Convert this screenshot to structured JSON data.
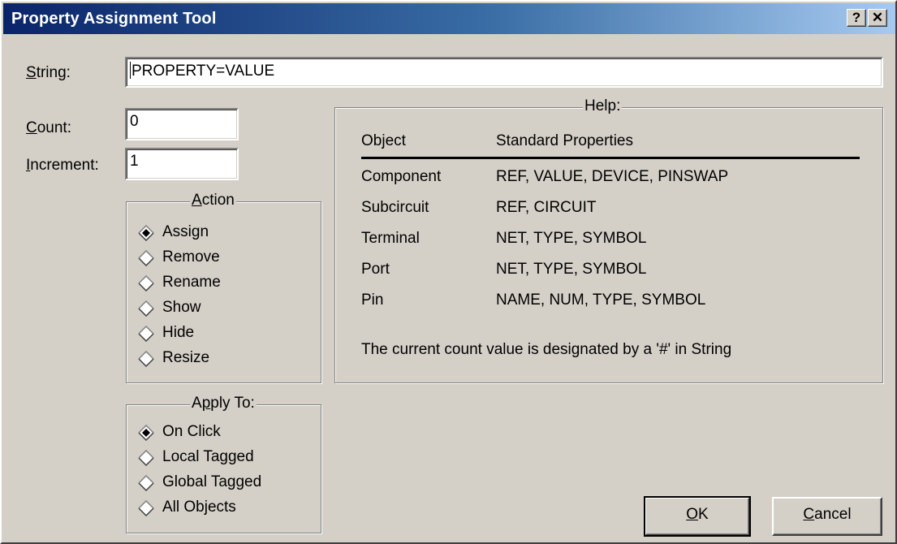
{
  "window": {
    "title": "Property Assignment Tool",
    "help_button": "?",
    "close_button": "✕"
  },
  "string_field": {
    "label_key": "S",
    "label_rest": "tring:",
    "value": "PROPERTY=VALUE"
  },
  "count_field": {
    "label_key": "C",
    "label_rest": "ount:",
    "value": "0"
  },
  "increment_field": {
    "label_key": "I",
    "label_rest": "ncrement:",
    "value": "1"
  },
  "action_group": {
    "legend_key": "A",
    "legend_rest": "ction",
    "options": [
      {
        "label": "Assign",
        "selected": true
      },
      {
        "label": "Remove",
        "selected": false
      },
      {
        "label": "Rename",
        "selected": false
      },
      {
        "label": "Show",
        "selected": false
      },
      {
        "label": "Hide",
        "selected": false
      },
      {
        "label": "Resize",
        "selected": false
      }
    ]
  },
  "apply_group": {
    "legend_pre": "A",
    "legend_key": "p",
    "legend_rest": "ply To:",
    "options": [
      {
        "label": "On Click",
        "selected": true
      },
      {
        "label": "Local Tagged",
        "selected": false
      },
      {
        "label": "Global Tagged",
        "selected": false
      },
      {
        "label": "All Objects",
        "selected": false
      }
    ]
  },
  "help": {
    "legend": "Help:",
    "col_object": "Object",
    "col_props": "Standard Properties",
    "rows": [
      {
        "object": "Component",
        "props": "REF, VALUE, DEVICE, PINSWAP"
      },
      {
        "object": "Subcircuit",
        "props": "REF, CIRCUIT"
      },
      {
        "object": "Terminal",
        "props": "NET, TYPE, SYMBOL"
      },
      {
        "object": "Port",
        "props": "NET, TYPE, SYMBOL"
      },
      {
        "object": "Pin",
        "props": "NAME, NUM, TYPE, SYMBOL"
      }
    ],
    "note": "The current count value is designated by a '#' in String"
  },
  "buttons": {
    "ok_key": "O",
    "ok_rest": "K",
    "cancel_key": "C",
    "cancel_rest": "ancel"
  }
}
